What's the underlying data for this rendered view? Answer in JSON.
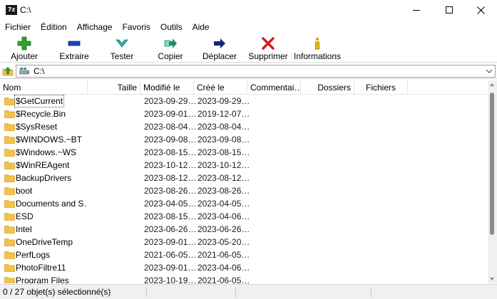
{
  "window": {
    "title": "C:\\",
    "app_icon_text": "7z"
  },
  "menu": [
    "Fichier",
    "Édition",
    "Affichage",
    "Favoris",
    "Outils",
    "Aide"
  ],
  "toolbar": [
    {
      "label": "Ajouter",
      "icon": "plus-icon",
      "color": "#2ea02e"
    },
    {
      "label": "Extraire",
      "icon": "minus-icon",
      "color": "#1f3fbf"
    },
    {
      "label": "Tester",
      "icon": "check-icon",
      "color": "#2bb3b3"
    },
    {
      "label": "Copier",
      "icon": "copy-arrow-icon",
      "color": "#1c8c6c"
    },
    {
      "label": "Déplacer",
      "icon": "move-arrow-icon",
      "color": "#1a237e"
    },
    {
      "label": "Supprimer",
      "icon": "delete-x-icon",
      "color": "#d32020"
    },
    {
      "label": "Informations",
      "icon": "info-icon",
      "color": "#d4a000"
    }
  ],
  "address": {
    "path": "C:\\",
    "up_icon": "folder-up-icon",
    "drive_icon": "drive-icon"
  },
  "columns": [
    "Nom",
    "Taille",
    "Modifié le",
    "Créé le",
    "Commentai…",
    "Dossiers",
    "Fichiers"
  ],
  "files": [
    {
      "name": "$GetCurrent",
      "modified": "2023-09-29…",
      "created": "2023-09-29…",
      "selected": true
    },
    {
      "name": "$Recycle.Bin",
      "modified": "2023-09-01…",
      "created": "2019-12-07…"
    },
    {
      "name": "$SysReset",
      "modified": "2023-08-04…",
      "created": "2023-08-04…"
    },
    {
      "name": "$WINDOWS.~BT",
      "modified": "2023-09-08…",
      "created": "2023-09-08…"
    },
    {
      "name": "$Windows.~WS",
      "modified": "2023-08-15…",
      "created": "2023-08-15…"
    },
    {
      "name": "$WinREAgent",
      "modified": "2023-10-12…",
      "created": "2023-10-12…"
    },
    {
      "name": "BackupDrivers",
      "modified": "2023-08-12…",
      "created": "2023-08-12…"
    },
    {
      "name": "boot",
      "modified": "2023-08-26…",
      "created": "2023-08-26…"
    },
    {
      "name": "Documents and S…",
      "modified": "2023-04-05…",
      "created": "2023-04-05…"
    },
    {
      "name": "ESD",
      "modified": "2023-08-15…",
      "created": "2023-04-06…"
    },
    {
      "name": "Intel",
      "modified": "2023-06-26…",
      "created": "2023-06-26…"
    },
    {
      "name": "OneDriveTemp",
      "modified": "2023-09-01…",
      "created": "2023-05-20…"
    },
    {
      "name": "PerfLogs",
      "modified": "2021-06-05…",
      "created": "2021-06-05…"
    },
    {
      "name": "PhotoFiltre11",
      "modified": "2023-09-01…",
      "created": "2023-04-06…"
    },
    {
      "name": "Program Files",
      "modified": "2023-10-19…",
      "created": "2021-06-05…"
    }
  ],
  "status": {
    "text": "0 / 27 objet(s) sélectionné(s)"
  },
  "colors": {
    "folder": "#f2c14e",
    "folder_dark": "#d9a52b"
  }
}
